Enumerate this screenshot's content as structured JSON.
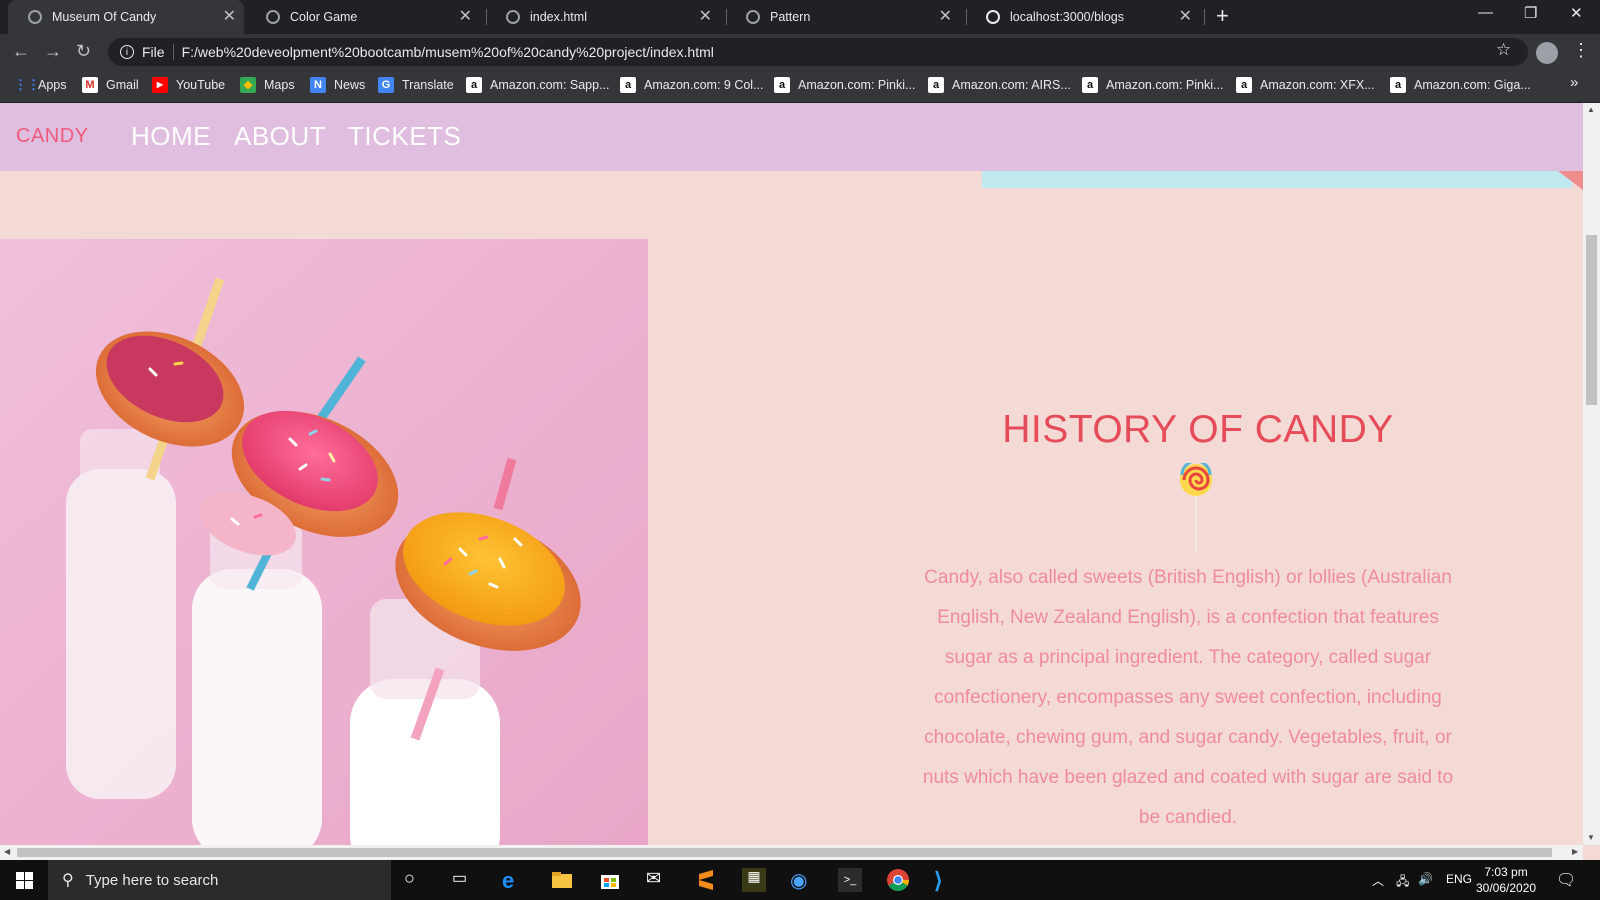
{
  "tabs": [
    {
      "title": "Museum Of Candy",
      "active": true
    },
    {
      "title": "Color Game",
      "active": false
    },
    {
      "title": "index.html",
      "active": false
    },
    {
      "title": "Pattern",
      "active": false
    },
    {
      "title": "localhost:3000/blogs",
      "active": false
    }
  ],
  "toolbar": {
    "file_label": "File",
    "url": "F:/web%20deveolpment%20bootcamb/musem%20of%20candy%20project/index.html"
  },
  "bookmarks": [
    {
      "label": "Apps",
      "icon": "apps-grid-icon"
    },
    {
      "label": "Gmail",
      "icon": "gmail-icon"
    },
    {
      "label": "YouTube",
      "icon": "youtube-icon"
    },
    {
      "label": "Maps",
      "icon": "maps-icon"
    },
    {
      "label": "News",
      "icon": "news-icon"
    },
    {
      "label": "Translate",
      "icon": "translate-icon"
    },
    {
      "label": "Amazon.com: Sapp...",
      "icon": "amazon-icon"
    },
    {
      "label": "Amazon.com: 9 Col...",
      "icon": "amazon-icon"
    },
    {
      "label": "Amazon.com: Pinki...",
      "icon": "amazon-icon"
    },
    {
      "label": "Amazon.com: AIRS...",
      "icon": "amazon-icon"
    },
    {
      "label": "Amazon.com: Pinki...",
      "icon": "amazon-icon"
    },
    {
      "label": "Amazon.com: XFX...",
      "icon": "amazon-icon"
    },
    {
      "label": "Amazon.com: Giga...",
      "icon": "amazon-icon"
    }
  ],
  "site": {
    "brand": "CANDY",
    "nav": [
      "HOME",
      "ABOUT",
      "TICKETS"
    ],
    "heading": "HISTORY OF CANDY",
    "paragraph": "Candy, also called sweets (British English) or lollies (Australian English, New Zealand English), is a confection that features sugar as a principal ingredient. The category, called sugar confectionery, encompasses any sweet confection, including chocolate, chewing gum, and sugar candy. Vegetables, fruit, or nuts which have been glazed and coated with sugar are said to be candied."
  },
  "taskbar": {
    "search_placeholder": "Type here to search",
    "language": "ENG",
    "time": "7:03 pm",
    "date": "30/06/2020"
  },
  "colors": {
    "nav_bg": "#dfbedf",
    "page_bg": "#f4dad5",
    "brand": "#ef5b7c",
    "heading": "#e64b5a",
    "paragraph": "#f08aa2",
    "stripe_blue": "#bfe8ef"
  }
}
